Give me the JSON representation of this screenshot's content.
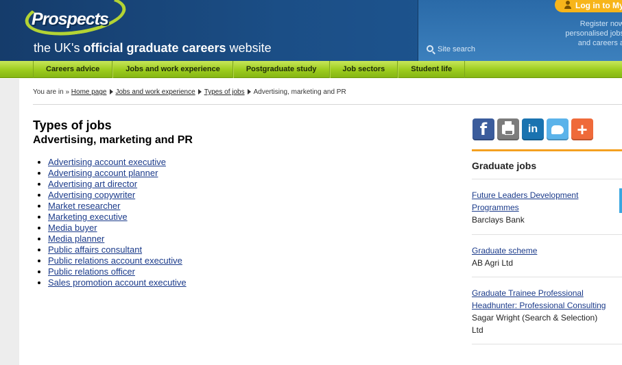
{
  "header": {
    "logo_text": "Prospects",
    "tagline_pre": "the UK's ",
    "tagline_bold": "official graduate careers",
    "tagline_post": " website",
    "login_label": "Log in to My",
    "register_line1": "Register now",
    "register_line2": "personalised jobs",
    "register_line3": "and careers a",
    "site_search_label": "Site search"
  },
  "nav": {
    "items": [
      "Careers advice",
      "Jobs and work experience",
      "Postgraduate study",
      "Job sectors",
      "Student life"
    ]
  },
  "breadcrumb": {
    "prefix": "You are in »",
    "links": [
      "Home page",
      "Jobs and work experience",
      "Types of jobs"
    ],
    "current": "Advertising, marketing and PR"
  },
  "main": {
    "title": "Types of jobs",
    "subtitle": "Advertising, marketing and PR",
    "jobs": [
      "Advertising account executive",
      "Advertising account planner",
      "Advertising art director",
      "Advertising copywriter",
      "Market researcher",
      "Marketing executive",
      "Media buyer",
      "Media planner",
      "Public affairs consultant",
      "Public relations account executive",
      "Public relations officer",
      "Sales promotion account executive"
    ]
  },
  "sidebar": {
    "share_icons": [
      "facebook-icon",
      "print-icon",
      "linkedin-icon",
      "twitter-icon",
      "add-more-icon"
    ],
    "share_glyphs": {
      "facebook": "f",
      "linkedin": "in",
      "plus": "+"
    },
    "title": "Graduate jobs",
    "jobs": [
      {
        "title_line1": "Future Leaders Development",
        "title_line2": "Programmes",
        "employer": "Barclays Bank"
      },
      {
        "title_line1": "Graduate scheme",
        "title_line2": "",
        "employer": "AB Agri Ltd"
      },
      {
        "title_line1": "Graduate Trainee Professional",
        "title_line2": "Headhunter: Professional Consulting",
        "employer_line1": "Sagar Wright (Search & Selection)",
        "employer_line2": "Ltd"
      }
    ]
  },
  "colors": {
    "header_blue": "#1b4e86",
    "nav_green": "#9ccc1e",
    "logo_green": "#b3d334",
    "login_orange": "#f7b51a",
    "link_blue": "#1a3a8a",
    "accent_orange": "#f4a020"
  }
}
